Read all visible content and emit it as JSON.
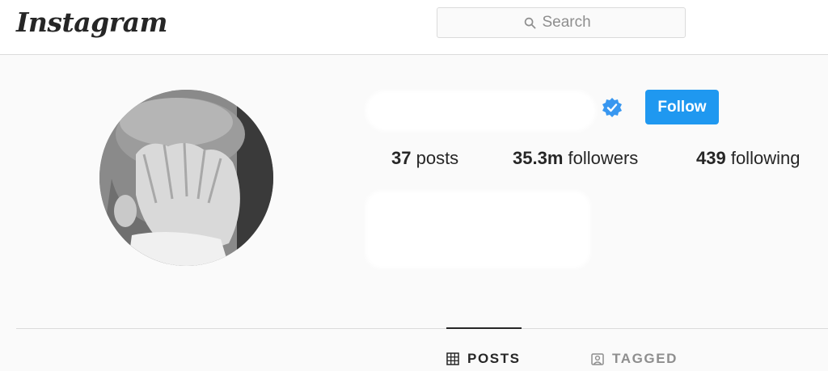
{
  "app": {
    "logo_text": "Instagram"
  },
  "search": {
    "placeholder": "Search",
    "icon": "search-icon"
  },
  "profile": {
    "verified_icon": "verified-badge-icon",
    "follow_label": "Follow",
    "stats": {
      "posts_count": "37",
      "posts_label": " posts",
      "followers_count": "35.3m",
      "followers_label": " followers",
      "following_count": "439",
      "following_label": " following"
    }
  },
  "tabs": [
    {
      "label": "POSTS",
      "icon": "grid-icon",
      "active": true
    },
    {
      "label": "TAGGED",
      "icon": "tagged-person-icon",
      "active": false
    }
  ],
  "colors": {
    "accent": "#1f98f0",
    "verified": "#3897f0",
    "text": "#262626",
    "muted": "#8e8e8e",
    "border": "#dbdbdb",
    "background": "#fafafa"
  }
}
